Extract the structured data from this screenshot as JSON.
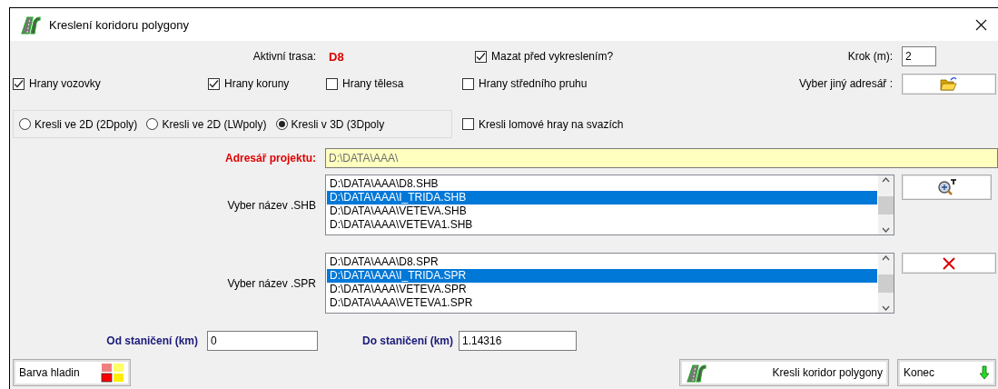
{
  "window": {
    "title": "Kreslení koridoru polygony"
  },
  "active_route": {
    "label": "Aktivní trasa:",
    "value": "D8"
  },
  "delete_before": {
    "label": "Mazat před vykreslením?",
    "checked": true
  },
  "step": {
    "label": "Krok (m):",
    "value": "2"
  },
  "edges": [
    {
      "label": "Hrany vozovky",
      "checked": true
    },
    {
      "label": "Hrany koruny",
      "checked": true
    },
    {
      "label": "Hrany tělesa",
      "checked": false
    },
    {
      "label": "Hrany středního pruhu",
      "checked": false
    }
  ],
  "folder": {
    "label": "Vyber jiný adresář :"
  },
  "draw_mode": [
    {
      "label": "Kresli ve 2D (2Dpoly)",
      "selected": false
    },
    {
      "label": "Kresli ve 2D (LWpoly)",
      "selected": false
    },
    {
      "label": "Kresli v 3D (3Dpoly",
      "selected": true
    }
  ],
  "break_lines": {
    "label": "Kresli lomové hray na svazích",
    "checked": false
  },
  "project_dir": {
    "label": "Adresář projektu:",
    "value": "D:\\DATA\\AAA\\"
  },
  "lists": [
    {
      "label": "Vyber název .SHB",
      "kind": "zoom",
      "items": [
        {
          "text": "D:\\DATA\\AAA\\D8.SHB",
          "selected": false
        },
        {
          "text": "D:\\DATA\\AAA\\I_TRIDA.SHB",
          "selected": true
        },
        {
          "text": "D:\\DATA\\AAA\\VETEVA.SHB",
          "selected": false
        },
        {
          "text": "D:\\DATA\\AAA\\VETEVA1.SHB",
          "selected": false
        }
      ]
    },
    {
      "label": "Vyber název .SPR",
      "kind": "delete",
      "items": [
        {
          "text": "D:\\DATA\\AAA\\D8.SPR",
          "selected": false
        },
        {
          "text": "D:\\DATA\\AAA\\I_TRIDA.SPR",
          "selected": true
        },
        {
          "text": "D:\\DATA\\AAA\\VETEVA.SPR",
          "selected": false
        },
        {
          "text": "D:\\DATA\\AAA\\VETEVA1.SPR",
          "selected": false
        }
      ]
    }
  ],
  "from": {
    "label": "Od staničení (km)",
    "value": "0"
  },
  "to": {
    "label": "Do staničení (km)",
    "value": "1.14316"
  },
  "buttons": {
    "colors": "Barva hladin",
    "draw": "Kresli koridor polygony",
    "close": "Konec"
  }
}
